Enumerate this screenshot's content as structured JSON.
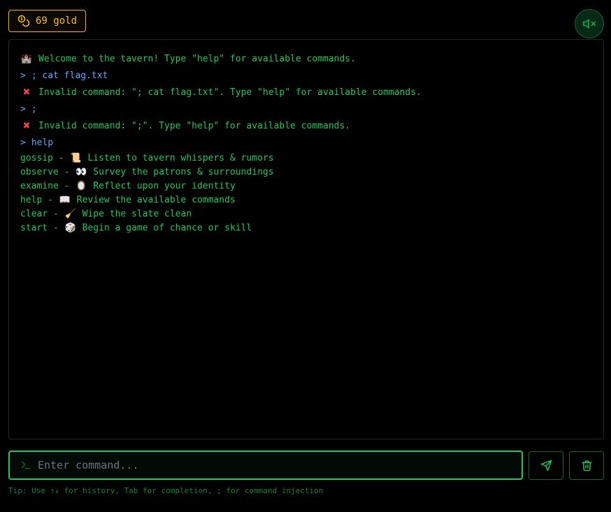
{
  "header": {
    "gold_amount": "69 gold",
    "gold_icon": "coins-icon",
    "mute_icon": "volume-x-icon"
  },
  "terminal": {
    "lines": [
      {
        "kind": "system",
        "icon": "🏰",
        "text": "Welcome to the tavern! Type \"help\" for available commands."
      },
      {
        "kind": "user",
        "prompt": ">",
        "text": "; cat flag.txt"
      },
      {
        "kind": "error",
        "icon": "✖",
        "text": "Invalid command: \"; cat flag.txt\". Type \"help\" for available commands."
      },
      {
        "kind": "user",
        "prompt": ">",
        "text": ";"
      },
      {
        "kind": "error",
        "icon": "✖",
        "text": "Invalid command: \";\". Type \"help\" for available commands."
      },
      {
        "kind": "user",
        "prompt": ">",
        "text": "help"
      }
    ],
    "help": [
      {
        "command": "gossip",
        "icon": "📜",
        "description": "Listen to tavern whispers & rumors"
      },
      {
        "command": "observe",
        "icon": "👀",
        "description": "Survey the patrons & surroundings"
      },
      {
        "command": "examine",
        "icon": "🪞",
        "description": "Reflect upon your identity"
      },
      {
        "command": "help",
        "icon": "📖",
        "description": "Review the available commands"
      },
      {
        "command": "clear",
        "icon": "🧹",
        "description": "Wipe the slate clean"
      },
      {
        "command": "start",
        "icon": "🎲",
        "description": "Begin a game of chance or skill"
      }
    ]
  },
  "input": {
    "placeholder": "Enter command...",
    "value": "",
    "prompt_icon": "terminal-prompt-icon",
    "send_icon": "send-icon",
    "clear_icon": "trash-icon"
  },
  "tip": "Tip: Use ↑↓ for history, Tab for completion, ; for command injection",
  "colors": {
    "accent_green": "#22c55e",
    "user_blue": "#60a5fa",
    "gold": "#fbbf24",
    "error_red": "#ef4444"
  }
}
